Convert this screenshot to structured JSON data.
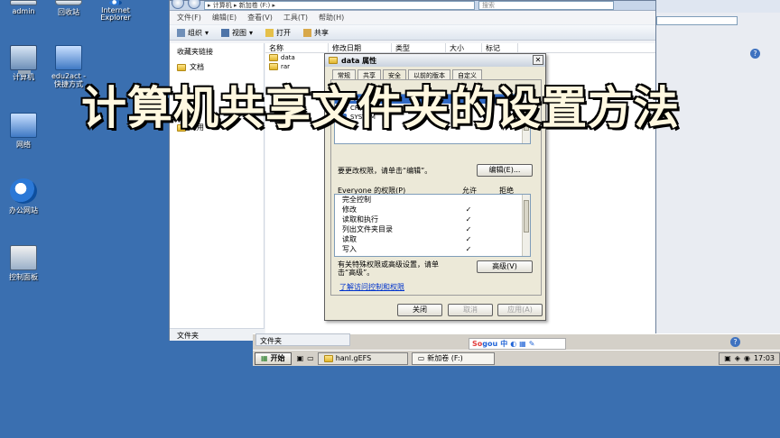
{
  "desktop": {
    "icons": [
      {
        "label": "admin",
        "icon": "user-folder-icon"
      },
      {
        "label": "回收站",
        "icon": "recycle-bin-icon"
      },
      {
        "label": "Internet Explorer",
        "icon": "ie-icon"
      },
      {
        "label": "计算机",
        "icon": "computer-icon"
      },
      {
        "label": "edu2act - 快捷方式",
        "icon": "shortcut-icon"
      },
      {
        "label": "网络",
        "icon": "network-icon"
      },
      {
        "label": "办公网站",
        "icon": "ie-icon"
      },
      {
        "label": "控制面板",
        "icon": "control-panel-icon"
      }
    ]
  },
  "explorer": {
    "address": "▸ 计算机 ▸ 新加卷 (F:) ▸",
    "search_placeholder": "搜索",
    "menu": [
      "文件(F)",
      "编辑(E)",
      "查看(V)",
      "工具(T)",
      "帮助(H)"
    ],
    "toolbar": {
      "organize": "组织",
      "views": "视图",
      "open": "打开",
      "share": "共享"
    },
    "sidebar_title": "收藏夹链接",
    "sidebar_items": [
      "文档",
      "公用"
    ],
    "sidebar_footer": "文件夹",
    "columns": [
      "名称",
      "修改日期",
      "类型",
      "大小",
      "标记"
    ],
    "files": [
      "data",
      "rar"
    ],
    "bottom_label": "文件夹"
  },
  "dialog": {
    "title": "data 属性",
    "tabs": [
      "常规",
      "共享",
      "安全",
      "以前的版本",
      "自定义"
    ],
    "users": [
      "Everyone",
      "CREATOR OWNER",
      "SYSTEM"
    ],
    "change_hint": "要更改权限，请单击“编辑”。",
    "edit_button": "编辑(E)...",
    "perm_header": "Everyone 的权限(P)",
    "allow_label": "允许",
    "deny_label": "拒绝",
    "permissions": [
      {
        "name": "完全控制",
        "allow": ""
      },
      {
        "name": "修改",
        "allow": "✓"
      },
      {
        "name": "读取和执行",
        "allow": "✓"
      },
      {
        "name": "列出文件夹目录",
        "allow": "✓"
      },
      {
        "name": "读取",
        "allow": "✓"
      },
      {
        "name": "写入",
        "allow": "✓"
      }
    ],
    "advanced_hint": "有关特殊权限或高级设置，请单击“高级”。",
    "advanced_button": "高级(V)",
    "link": "了解访问控制和权限",
    "ok": "关闭",
    "cancel": "取消",
    "apply": "应用(A)"
  },
  "overlay_title": "计算机共享文件夹的设置方法",
  "ime": {
    "brand_s": "So",
    "brand_g": "gou",
    "mode": "中"
  },
  "taskbar": {
    "start": "开始",
    "tasks": [
      "hanl.gEFS",
      "新加卷 (F:)"
    ],
    "clock": "17:03"
  }
}
